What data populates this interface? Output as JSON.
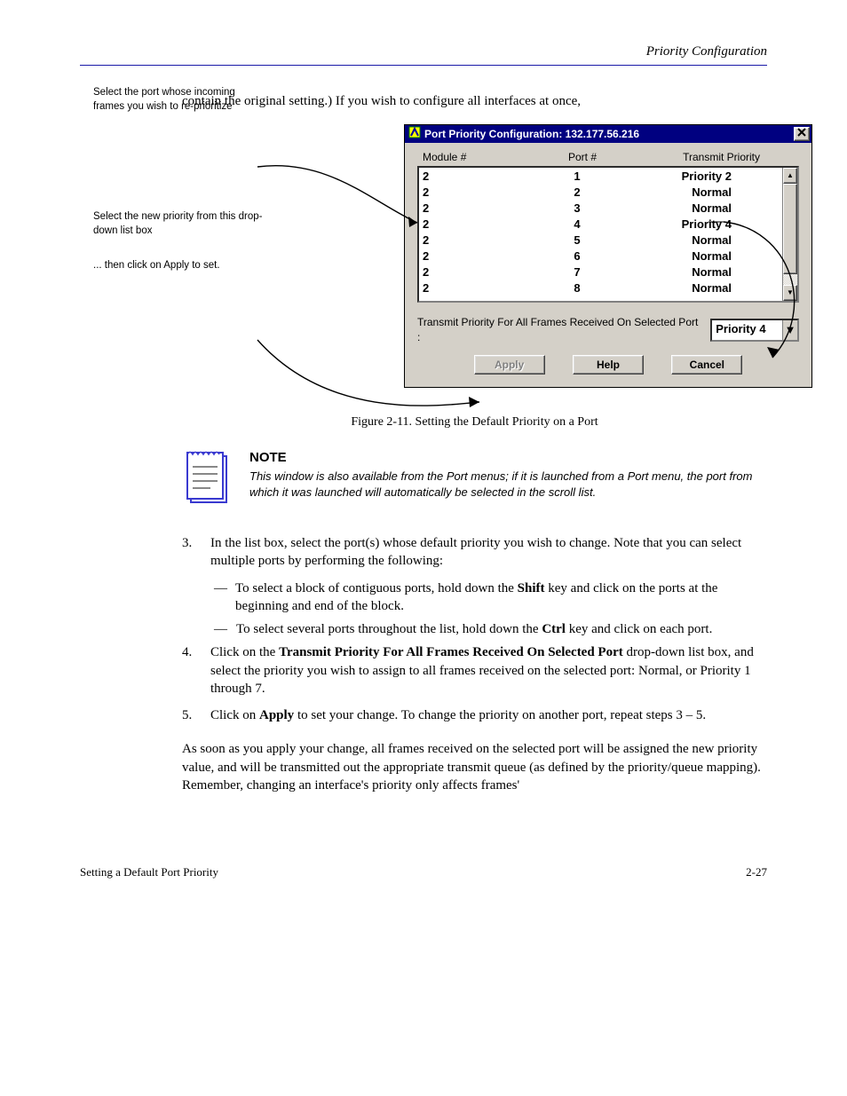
{
  "header": {
    "section_title": "Priority Configuration"
  },
  "intro": "contain the original setting.) If you wish to configure all interfaces at once,",
  "fig": {
    "label": "Figure 2-11. Setting the Default Priority on a Port"
  },
  "window": {
    "title": "Port Priority Configuration: 132.177.56.216",
    "columns": {
      "module": "Module #",
      "port": "Port #",
      "priority": "Transmit Priority"
    },
    "rows": [
      {
        "module": "2",
        "port": "1",
        "priority": "Priority 2"
      },
      {
        "module": "2",
        "port": "2",
        "priority": "Normal"
      },
      {
        "module": "2",
        "port": "3",
        "priority": "Normal"
      },
      {
        "module": "2",
        "port": "4",
        "priority": "Priority 4"
      },
      {
        "module": "2",
        "port": "5",
        "priority": "Normal"
      },
      {
        "module": "2",
        "port": "6",
        "priority": "Normal"
      },
      {
        "module": "2",
        "port": "7",
        "priority": "Normal"
      },
      {
        "module": "2",
        "port": "8",
        "priority": "Normal"
      }
    ],
    "prio_label": "Transmit Priority For All Frames Received On Selected Port :",
    "prio_value": "Priority 4",
    "buttons": {
      "apply": "Apply",
      "help": "Help",
      "cancel": "Cancel"
    }
  },
  "annotations": {
    "select_port": "Select the port whose incoming frames you wish to re-prioritize",
    "select_priority": "Select the new priority from this drop-down list box",
    "apply": "... then click on Apply to set."
  },
  "note": {
    "head": "NOTE",
    "body": "This window is also available from the Port menus; if it is launched from a Port menu, the port from which it was launched will automatically be selected in the scroll list."
  },
  "steps": {
    "s3": "In the list box, select the port(s) whose default priority you wish to change. Note that you can select multiple ports by performing the following:",
    "s3a_pre": "To select a block of contiguous ports, hold down the ",
    "s3a_key": "Shift",
    "s3a_post": " key and click on the ports at the beginning and end of the block.",
    "s3b_pre": "To select several ports throughout the list, hold down the ",
    "s3b_key": "Ctrl",
    "s3b_post": " key and click on each port.",
    "s4_pre": "Click on the ",
    "s4_field": "Transmit Priority For All Frames Received On Selected Port",
    "s4_post": " drop-down list box, and select the priority you wish to assign to all frames received on the selected port: Normal, or Priority 1 through 7.",
    "s5_pre": "Click on ",
    "s5_btn": "Apply",
    "s5_post": " to set your change. To change the priority on another port, repeat steps 3 – 5."
  },
  "closing": "As soon as you apply your change, all frames received on the selected port will be assigned the new priority value, and will be transmitted out the appropriate transmit queue (as defined by the priority/queue mapping). Remember, changing an interface's priority only affects frames'",
  "footer": {
    "left": "Setting a Default Port Priority",
    "right": "2-27"
  }
}
